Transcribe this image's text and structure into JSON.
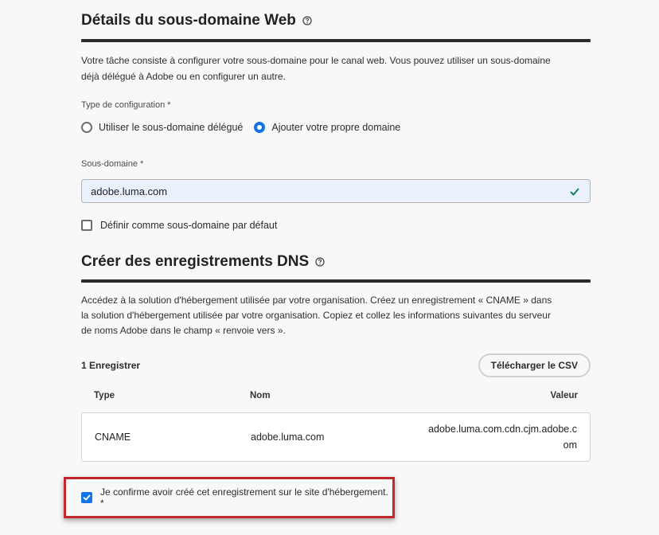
{
  "web_subdomain": {
    "title": "Détails du sous-domaine Web",
    "help_icon": "help-circle-icon",
    "description": "Votre tâche consiste à configurer votre sous-domaine pour le canal web. Vous pouvez utiliser un sous-domaine déjà délégué à Adobe ou en configurer un autre.",
    "config_type_label": "Type de configuration",
    "required_mark": "*",
    "options": [
      {
        "label": "Utiliser le sous-domaine délégué",
        "selected": false
      },
      {
        "label": "Ajouter votre propre domaine",
        "selected": true
      }
    ],
    "subdomain_label": "Sous-domaine",
    "subdomain_value": "adobe.luma.com",
    "valid_icon": "checkmark-icon",
    "default_checkbox_label": "Définir comme sous-domaine par défaut",
    "default_checked": false
  },
  "dns": {
    "title": "Créer des enregistrements DNS",
    "help_icon": "help-circle-icon",
    "description": "Accédez à la solution d'hébergement utilisée par votre organisation. Créez un enregistrement « CNAME » dans la solution d'hébergement utilisée par votre organisation. Copiez et collez les informations suivantes du serveur de noms Adobe dans le champ « renvoie vers ».",
    "records_count": "1 Enregistrer",
    "download_button": "Télécharger le CSV",
    "columns": {
      "type": "Type",
      "name": "Nom",
      "value": "Valeur"
    },
    "rows": [
      {
        "type": "CNAME",
        "name": "adobe.luma.com",
        "value": "adobe.luma.com.cdn.cjm.adobe.com"
      }
    ],
    "confirm_label": "Je confirme avoir créé cet enregistrement sur le site d'hébergement. *",
    "confirm_checked": true
  },
  "colors": {
    "accent": "#1473e6",
    "highlight_border": "#c0282d",
    "valid_green": "#12805c"
  }
}
